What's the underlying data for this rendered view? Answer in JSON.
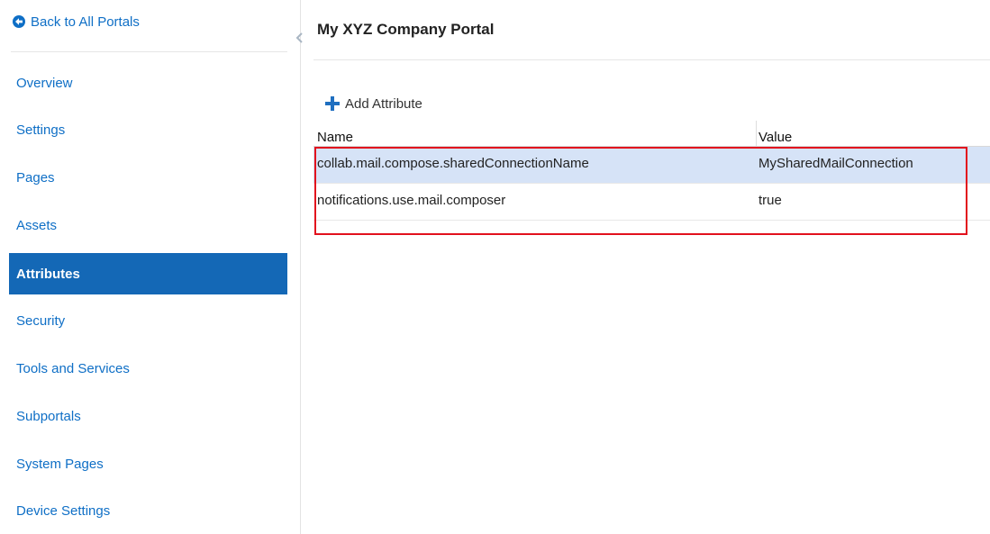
{
  "sidebar": {
    "back_label": "Back to All Portals",
    "items": [
      {
        "label": "Overview"
      },
      {
        "label": "Settings"
      },
      {
        "label": "Pages"
      },
      {
        "label": "Assets"
      },
      {
        "label": "Attributes",
        "active": true
      },
      {
        "label": "Security"
      },
      {
        "label": "Tools and Services"
      },
      {
        "label": "Subportals"
      },
      {
        "label": "System Pages"
      },
      {
        "label": "Device Settings"
      }
    ]
  },
  "main": {
    "title": "My XYZ Company Portal",
    "add_attribute_label": "Add Attribute",
    "table": {
      "columns": [
        "Name",
        "Value"
      ],
      "rows": [
        {
          "name": "collab.mail.compose.sharedConnectionName",
          "value": "MySharedMailConnection",
          "selected": true
        },
        {
          "name": "notifications.use.mail.composer",
          "value": "true",
          "selected": false
        }
      ]
    }
  },
  "colors": {
    "link": "#0f6fc6",
    "active_nav_bg": "#1468b6",
    "selected_row_bg": "#d6e3f7",
    "highlight_border": "#e2111d"
  },
  "icons": {
    "back": "circle-arrow-left-icon",
    "collapse": "chevron-left-icon",
    "add": "plus-icon"
  }
}
